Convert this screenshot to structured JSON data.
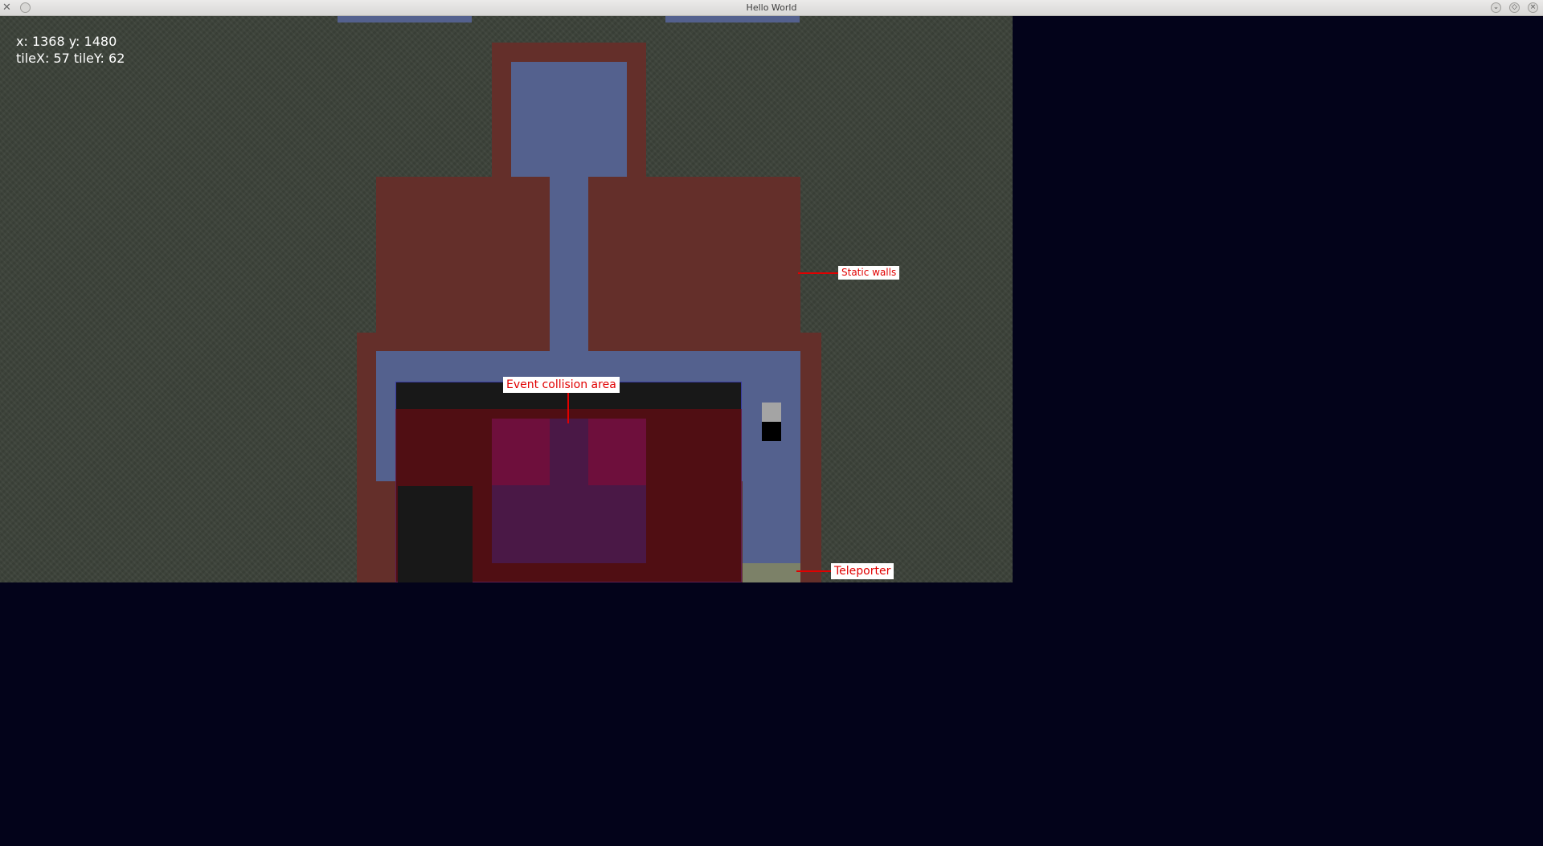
{
  "window": {
    "title": "Hello World",
    "app_icon": "x-icon",
    "controls": [
      "minimize-icon",
      "maximize-icon",
      "close-icon"
    ]
  },
  "hud": {
    "position": "x: 1368 y: 1480",
    "tile": "tileX: 57 tileY: 62"
  },
  "annotations": {
    "static_walls": "Static walls",
    "event_collision_area": "Event collision area",
    "teleporter": "Teleporter"
  },
  "colors": {
    "grass": "#3c4239",
    "wall": "#642f2a",
    "floor": "#54618e",
    "dark_floor": "#181818",
    "collision_overlay": "#8a0a14",
    "teleporter": "#7c8168",
    "annotation_text": "#e10000",
    "background": "#03031a"
  }
}
